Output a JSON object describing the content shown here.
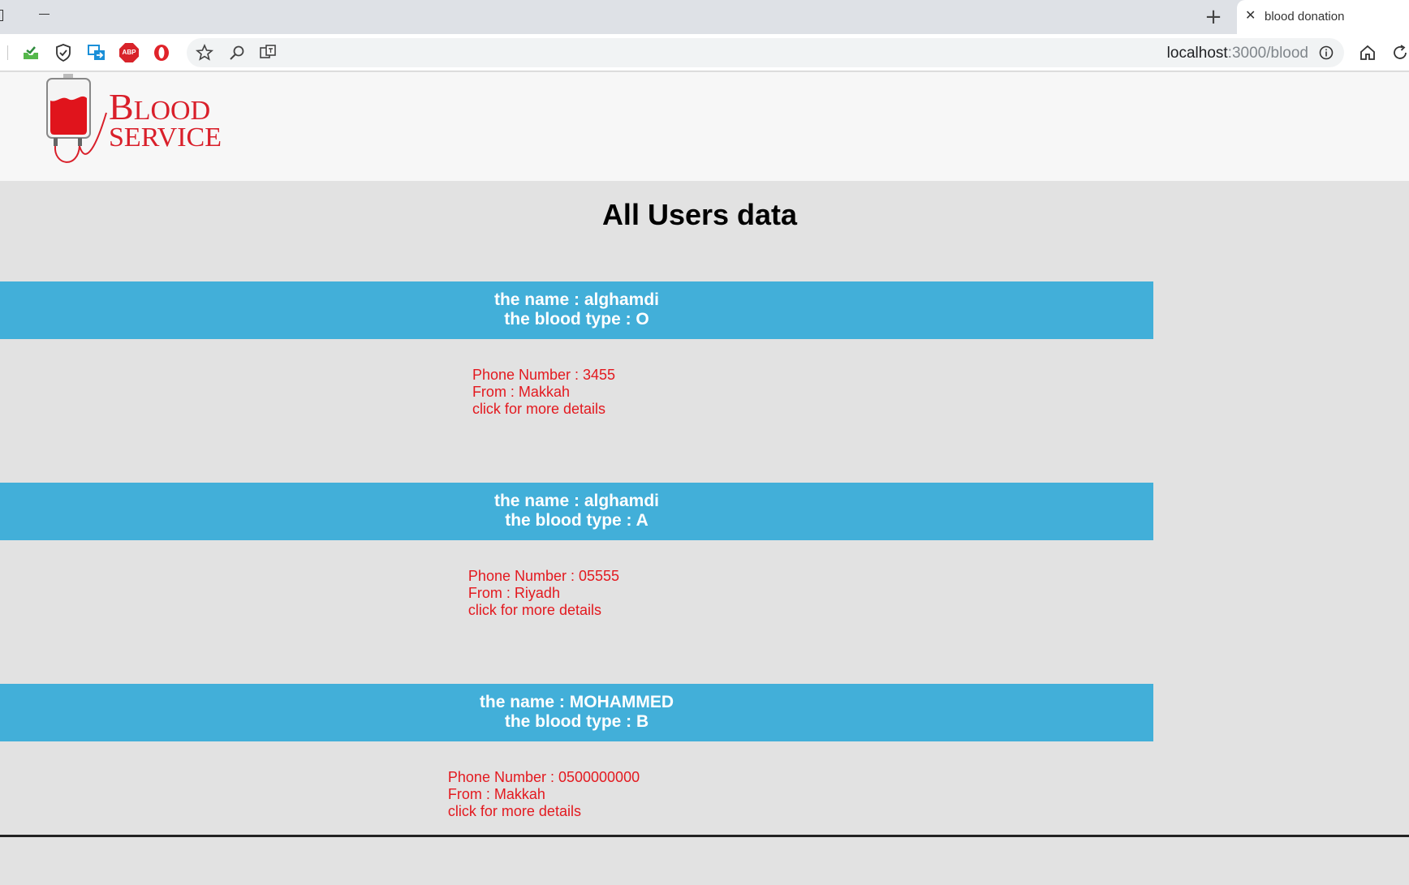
{
  "browser": {
    "tab_title": "blood donation",
    "tab_close_icon": "close-icon",
    "new_tab_icon": "plus-icon",
    "url_host": "localhost",
    "url_rest": ":3000/blood",
    "extensions": [
      "inbox-check-icon",
      "shield-check-icon",
      "screenshot-icon",
      "adblock-icon",
      "opera-icon"
    ],
    "abp_label": "ABP"
  },
  "header": {
    "logo_line1_cap": "B",
    "logo_line1_rest": "LOOD",
    "logo_line2_cap": "S",
    "logo_line2_rest": "ERVICE",
    "brand_color": "#d91f2a"
  },
  "page": {
    "title": "All Users data",
    "header_bar_color": "#42afd9",
    "detail_text_color": "#e3191f"
  },
  "users": [
    {
      "name_line": "the name : alghamdi",
      "blood_line": "the blood type : O",
      "phone_line": "Phone Number : 3455",
      "from_line": "From : Makkah",
      "link_text": "click for more details"
    },
    {
      "name_line": "the name : alghamdi",
      "blood_line": "the blood type : A",
      "phone_line": "Phone Number : 05555",
      "from_line": "From : Riyadh",
      "link_text": "click for more details"
    },
    {
      "name_line": "the name : MOHAMMED",
      "blood_line": "the blood type : B",
      "phone_line": "Phone Number : 0500000000",
      "from_line": "From : Makkah",
      "link_text": "click for more details"
    }
  ]
}
